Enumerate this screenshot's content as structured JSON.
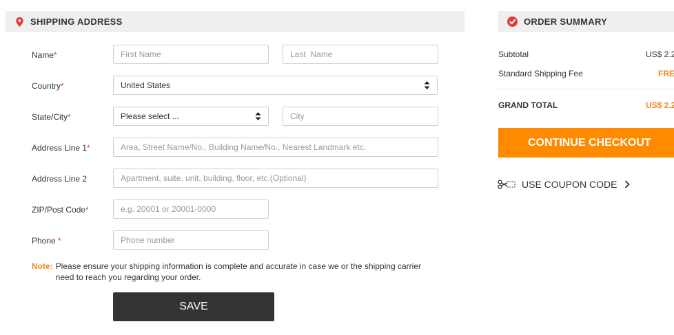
{
  "shipping": {
    "title": "SHIPPING ADDRESS",
    "name_label": "Name",
    "first_name_placeholder": "First Name",
    "last_name_placeholder": "Last  Name",
    "country_label": "Country",
    "country_value": "United States",
    "state_city_label": "State/City",
    "state_value": "Please select ...",
    "city_placeholder": "City",
    "address1_label": "Address Line 1",
    "address1_placeholder": "Area, Street Name/No., Building Name/No., Nearest Landmark etc.",
    "address2_label": "Address Line 2",
    "address2_placeholder": "Apartment, suite, unit, building, floor, etc.(Optional)",
    "zip_label": "ZIP/Post Code",
    "zip_placeholder": "e.g. 20001 or 20001-0000",
    "phone_label": "Phone ",
    "phone_placeholder": "Phone number",
    "required_mark": "*",
    "note_label": "Note:",
    "note_text": "Please ensure your shipping information is complete and accurate in case we or the shipping carrier need to reach you regarding your order.",
    "save_label": "SAVE"
  },
  "summary": {
    "title": "ORDER SUMMARY",
    "subtotal_label": "Subtotal",
    "subtotal_value": "US$ 2.2",
    "shipping_fee_label": "Standard Shipping Fee",
    "shipping_fee_value": "FRE",
    "grand_total_label": "GRAND TOTAL",
    "grand_total_value": "US$ 2.2",
    "checkout_label": "CONTINUE CHECKOUT",
    "coupon_label": "USE COUPON CODE"
  },
  "colors": {
    "accent_orange": "#ff8a00",
    "required_red": "#e03a3a",
    "header_bg": "#efefef",
    "save_bg": "#333333"
  },
  "icons": {
    "shipping": "map-pin-icon",
    "summary": "order-badge-icon",
    "coupon": "scissors-coupon-icon",
    "coupon_arrow": "chevron-right-icon",
    "select_arrows": "up-down-arrows-icon"
  }
}
